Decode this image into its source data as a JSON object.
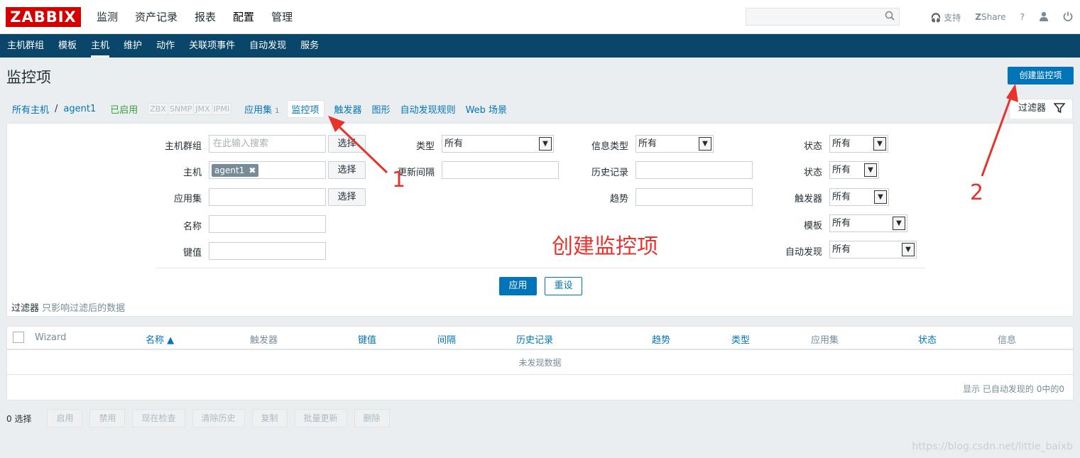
{
  "header": {
    "logo": "ZABBIX",
    "menu": [
      "监测",
      "资产记录",
      "报表",
      "配置",
      "管理"
    ],
    "active_menu": "配置",
    "search_placeholder": "",
    "links": {
      "support": "支持",
      "share": "Share",
      "help": "?"
    }
  },
  "subnav": {
    "items": [
      "主机群组",
      "模板",
      "主机",
      "维护",
      "动作",
      "关联项事件",
      "自动发现",
      "服务"
    ],
    "active": "主机"
  },
  "page": {
    "title": "监控项",
    "create_button": "创建监控项"
  },
  "breadcrumb": {
    "all_hosts": "所有主机",
    "sep": "/",
    "host": "agent1",
    "status": "已启用",
    "protocols": [
      "ZBX",
      "SNMP",
      "JMX",
      "IPMI"
    ],
    "tabs": [
      {
        "label": "应用集",
        "count": "1"
      },
      {
        "label": "监控项",
        "count": ""
      },
      {
        "label": "触发器",
        "count": ""
      },
      {
        "label": "图形",
        "count": ""
      },
      {
        "label": "自动发现规则",
        "count": ""
      },
      {
        "label": "Web 场景",
        "count": ""
      }
    ]
  },
  "filter_tab": "过滤器",
  "filter": {
    "host_group": {
      "label": "主机群组",
      "placeholder": "在此输入搜索",
      "button": "选择"
    },
    "host": {
      "label": "主机",
      "tag": "agent1",
      "button": "选择"
    },
    "application": {
      "label": "应用集",
      "value": "",
      "button": "选择"
    },
    "name": {
      "label": "名称",
      "value": ""
    },
    "key": {
      "label": "键值",
      "value": ""
    },
    "type": {
      "label": "类型",
      "value": "所有"
    },
    "interval": {
      "label": "更新间隔",
      "value": ""
    },
    "info_type": {
      "label": "信息类型",
      "value": "所有"
    },
    "history": {
      "label": "历史记录",
      "value": ""
    },
    "trends": {
      "label": "趋势",
      "value": ""
    },
    "state": {
      "label": "状态",
      "value": "所有"
    },
    "status": {
      "label": "状态",
      "value": "所有"
    },
    "triggers": {
      "label": "触发器",
      "value": "所有"
    },
    "template": {
      "label": "模板",
      "value": "所有"
    },
    "discovery": {
      "label": "自动发现",
      "value": "所有"
    },
    "apply": "应用",
    "reset": "重设",
    "note_bold": "过滤器",
    "note": "只影响过滤后的数据"
  },
  "annotations": {
    "title": "创建监控项",
    "num1": "1",
    "num2": "2",
    "color": "#e8322c"
  },
  "table": {
    "columns": [
      "Wizard",
      "名称 ▲",
      "触发器",
      "键值",
      "间隔",
      "历史记录",
      "趋势",
      "类型",
      "应用集",
      "状态",
      "信息"
    ],
    "empty": "未发现数据",
    "footer": "显示 已自动发现的 0中的0"
  },
  "actions": {
    "count": "0 选择",
    "buttons": [
      "启用",
      "禁用",
      "现在检查",
      "清除历史",
      "复制",
      "批量更新",
      "删除"
    ]
  },
  "watermark": "https://blog.csdn.net/little_baixb",
  "colors": {
    "brand": "#d40000",
    "nav": "#0a466a",
    "link": "#0275b8",
    "enabled": "#3a9e3a"
  }
}
